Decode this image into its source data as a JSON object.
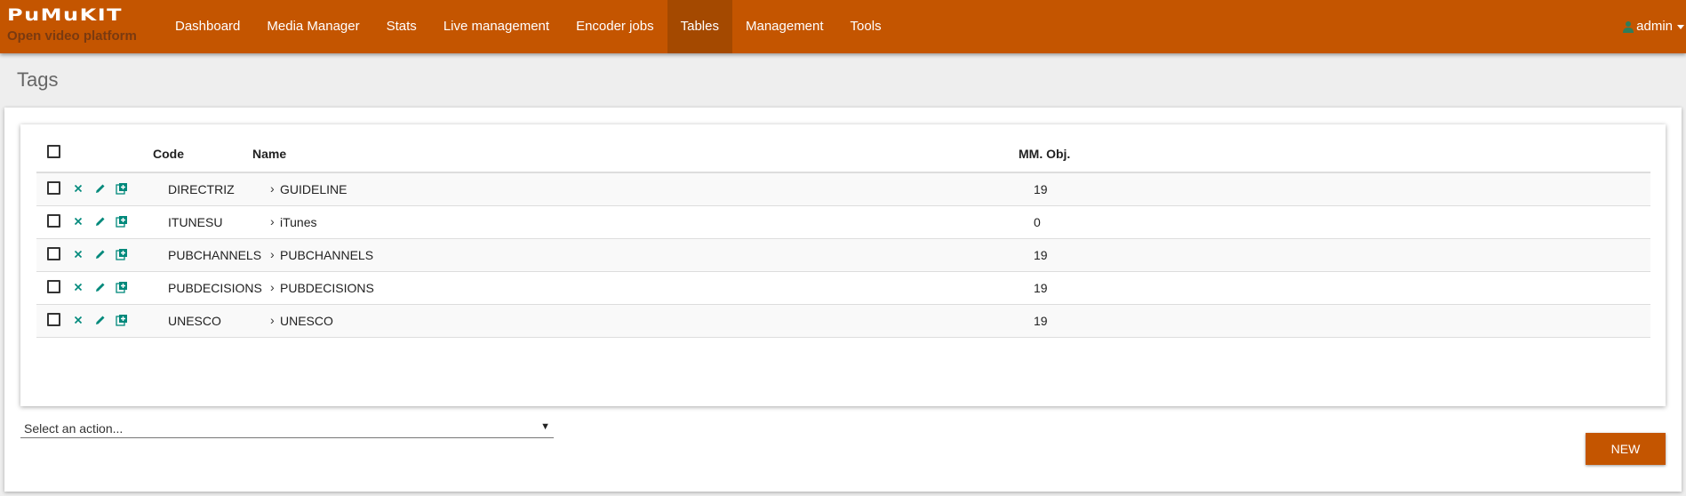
{
  "brand": {
    "logo_text": "PuMuKIT",
    "tagline": "Open video platform",
    "primary_color": "#c45500"
  },
  "nav": {
    "items": [
      {
        "label": "Dashboard",
        "active": false
      },
      {
        "label": "Media Manager",
        "active": false
      },
      {
        "label": "Stats",
        "active": false
      },
      {
        "label": "Live management",
        "active": false
      },
      {
        "label": "Encoder jobs",
        "active": false
      },
      {
        "label": "Tables",
        "active": true
      },
      {
        "label": "Management",
        "active": false
      },
      {
        "label": "Tools",
        "active": false
      }
    ],
    "user": {
      "name": "admin",
      "icon": "user-icon"
    }
  },
  "page": {
    "title": "Tags"
  },
  "table": {
    "columns": {
      "code": "Code",
      "name": "Name",
      "mm_obj": "MM. Obj."
    },
    "row_icons": [
      "checkbox",
      "delete-icon",
      "edit-icon",
      "add-child-icon"
    ],
    "rows": [
      {
        "code": "DIRECTRIZ",
        "name": "GUIDELINE",
        "mm_obj": "19"
      },
      {
        "code": "ITUNESU",
        "name": "iTunes",
        "mm_obj": "0"
      },
      {
        "code": "PUBCHANNELS",
        "name": "PUBCHANNELS",
        "mm_obj": "19"
      },
      {
        "code": "PUBDECISIONS",
        "name": "PUBDECISIONS",
        "mm_obj": "19"
      },
      {
        "code": "UNESCO",
        "name": "UNESCO",
        "mm_obj": "19"
      }
    ]
  },
  "actions": {
    "select_placeholder": "Select an action...",
    "new_label": "NEW"
  },
  "colors": {
    "icon_teal": "#00897b",
    "navbar_active": "#a44900"
  }
}
